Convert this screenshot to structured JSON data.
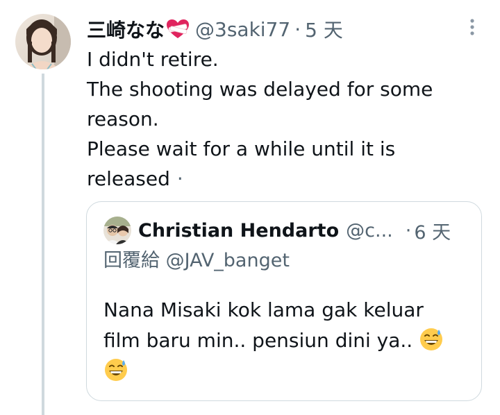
{
  "tweet": {
    "display_name": "三崎なな",
    "handle": "@3saki77",
    "separator": "·",
    "time": "5 天",
    "text_lines": [
      "I didn't retire.",
      "The shooting was delayed for some",
      "reason.",
      "Please wait for a while until it is",
      "released"
    ],
    "trailing": "·",
    "icons": {
      "name_decoration": "heart-with-bandage-icon",
      "more": "more-vertical-icon"
    }
  },
  "quoted_tweet": {
    "display_name": "Christian Hendarto",
    "handle": "@c...",
    "separator": "·",
    "time": "6 天",
    "reply_to_label": "回覆給 @JAV_banget",
    "text_lines": [
      "Nana Misaki kok lama gak keluar",
      "film baru min.. pensiun dini ya.."
    ],
    "emoji": "grinning-face-with-sweat-icon"
  },
  "colors": {
    "text_primary": "#0f1419",
    "text_secondary": "#536471",
    "border": "#cfd9de",
    "thread_line": "#cfd9de"
  }
}
